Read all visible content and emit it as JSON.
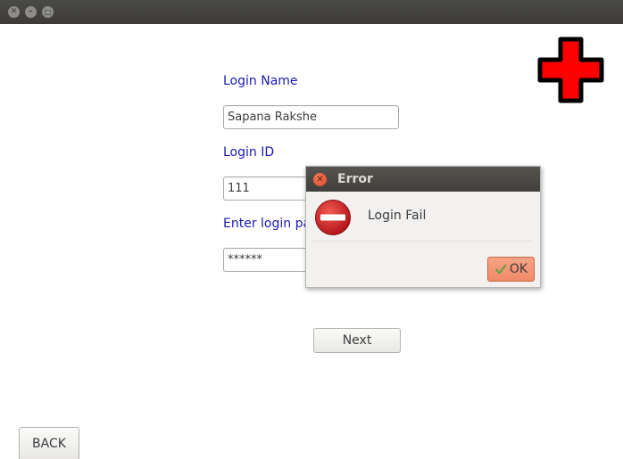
{
  "window": {
    "controls": [
      "close-icon",
      "minimize-icon",
      "maximize-icon"
    ]
  },
  "form": {
    "login_name_label": "Login Name",
    "login_name_value": "Sapana Rakshe",
    "login_id_label": "Login ID",
    "login_id_value": "111",
    "password_label": "Enter login pa",
    "password_value": "******",
    "next_label": "Next",
    "back_label": "BACK"
  },
  "logo": {
    "icon": "red-cross-icon",
    "color": "#ff0000"
  },
  "dialog": {
    "title": "Error",
    "message": "Login Fail",
    "ok_label": "OK",
    "icon": "error-stop-icon"
  },
  "colors": {
    "label_blue": "#1a1ab4",
    "titlebar": "#3c3b37",
    "ok_button": "#f0906d"
  }
}
